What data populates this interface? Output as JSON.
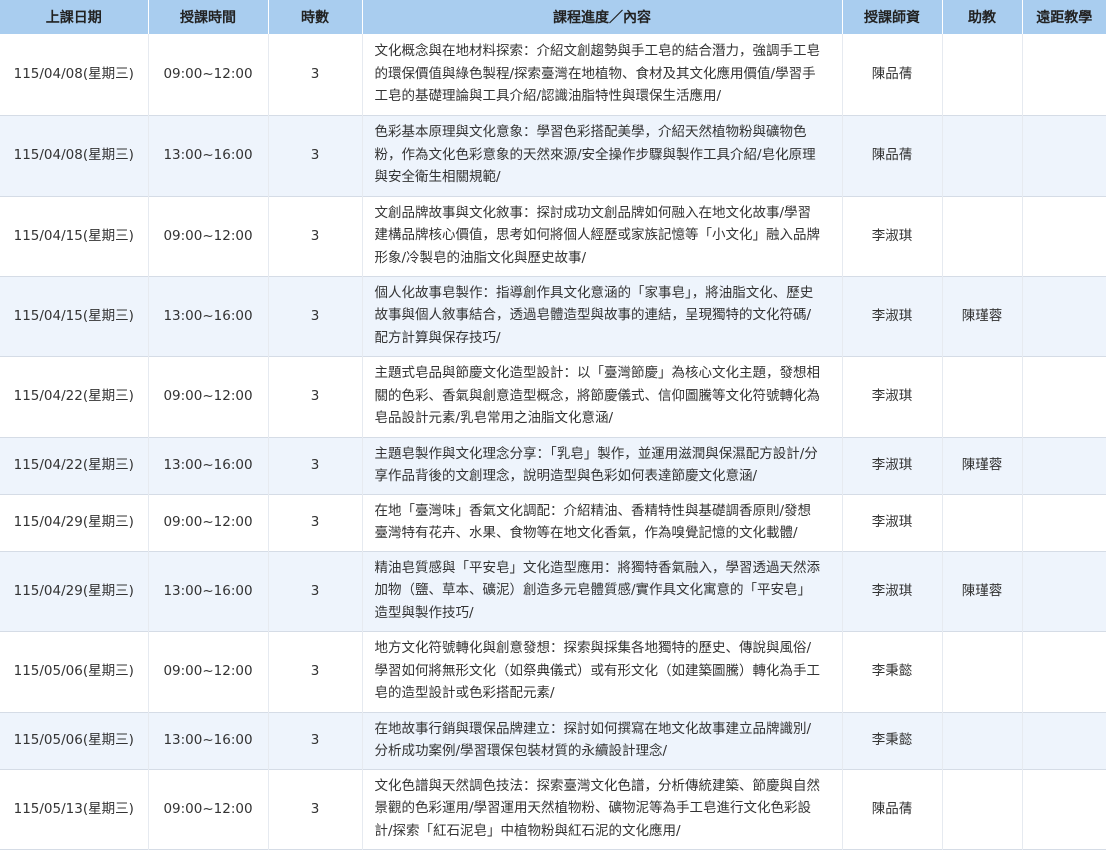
{
  "columns": [
    "上課日期",
    "授課時間",
    "時數",
    "課程進度／內容",
    "授課師資",
    "助教",
    "遠距教學"
  ],
  "rows": [
    {
      "date": "115/04/08(星期三)",
      "time": "09:00~12:00",
      "hours": "3",
      "content": "文化概念與在地材料探索：介紹文創趨勢與手工皂的結合潛力，強調手工皂的環保價值與綠色製程/探索臺灣在地植物、食材及其文化應用價值/學習手工皂的基礎理論與工具介紹/認識油脂特性與環保生活應用/",
      "teacher": "陳品蒨",
      "assistant": "",
      "remote": ""
    },
    {
      "date": "115/04/08(星期三)",
      "time": "13:00~16:00",
      "hours": "3",
      "content": "色彩基本原理與文化意象：學習色彩搭配美學，介紹天然植物粉與礦物色粉，作為文化色彩意象的天然來源/安全操作步驟與製作工具介紹/皂化原理與安全衛生相關規範/",
      "teacher": "陳品蒨",
      "assistant": "",
      "remote": ""
    },
    {
      "date": "115/04/15(星期三)",
      "time": "09:00~12:00",
      "hours": "3",
      "content": "文創品牌故事與文化敘事：探討成功文創品牌如何融入在地文化故事/學習建構品牌核心價值，思考如何將個人經歷或家族記憶等「小文化」融入品牌形象/冷製皂的油脂文化與歷史故事/",
      "teacher": "李淑琪",
      "assistant": "",
      "remote": ""
    },
    {
      "date": "115/04/15(星期三)",
      "time": "13:00~16:00",
      "hours": "3",
      "content": "個人化故事皂製作：指導創作具文化意涵的「家事皂」，將油脂文化、歷史故事與個人敘事結合，透過皂體造型與故事的連結，呈現獨特的文化符碼/配方計算與保存技巧/",
      "teacher": "李淑琪",
      "assistant": "陳瑾蓉",
      "remote": ""
    },
    {
      "date": "115/04/22(星期三)",
      "time": "09:00~12:00",
      "hours": "3",
      "content": "主題式皂品與節慶文化造型設計：以「臺灣節慶」為核心文化主題，發想相關的色彩、香氣與創意造型概念，將節慶儀式、信仰圖騰等文化符號轉化為皂品設計元素/乳皂常用之油脂文化意涵/",
      "teacher": "李淑琪",
      "assistant": "",
      "remote": ""
    },
    {
      "date": "115/04/22(星期三)",
      "time": "13:00~16:00",
      "hours": "3",
      "content": "主題皂製作與文化理念分享：「乳皂」製作，並運用滋潤與保濕配方設計/分享作品背後的文創理念，說明造型與色彩如何表達節慶文化意涵/",
      "teacher": "李淑琪",
      "assistant": "陳瑾蓉",
      "remote": ""
    },
    {
      "date": "115/04/29(星期三)",
      "time": "09:00~12:00",
      "hours": "3",
      "content": "在地「臺灣味」香氣文化調配：介紹精油、香精特性與基礎調香原則/發想臺灣特有花卉、水果、食物等在地文化香氣，作為嗅覺記憶的文化載體/",
      "teacher": "李淑琪",
      "assistant": "",
      "remote": ""
    },
    {
      "date": "115/04/29(星期三)",
      "time": "13:00~16:00",
      "hours": "3",
      "content": "精油皂質感與「平安皂」文化造型應用：將獨特香氣融入，學習透過天然添加物（鹽、草本、礦泥）創造多元皂體質感/實作具文化寓意的「平安皂」造型與製作技巧/",
      "teacher": "李淑琪",
      "assistant": "陳瑾蓉",
      "remote": ""
    },
    {
      "date": "115/05/06(星期三)",
      "time": "09:00~12:00",
      "hours": "3",
      "content": "地方文化符號轉化與創意發想：探索與採集各地獨特的歷史、傳說與風俗/學習如何將無形文化（如祭典儀式）或有形文化（如建築圖騰）轉化為手工皂的造型設計或色彩搭配元素/",
      "teacher": "李秉懿",
      "assistant": "",
      "remote": ""
    },
    {
      "date": "115/05/06(星期三)",
      "time": "13:00~16:00",
      "hours": "3",
      "content": "在地故事行銷與環保品牌建立：探討如何撰寫在地文化故事建立品牌識別/分析成功案例/學習環保包裝材質的永續設計理念/",
      "teacher": "李秉懿",
      "assistant": "",
      "remote": ""
    },
    {
      "date": "115/05/13(星期三)",
      "time": "09:00~12:00",
      "hours": "3",
      "content": "文化色譜與天然調色技法：探索臺灣文化色譜，分析傳統建築、節慶與自然景觀的色彩運用/學習運用天然植物粉、礦物泥等為手工皂進行文化色彩設計/探索「紅石泥皂」中植物粉與紅石泥的文化應用/",
      "teacher": "陳品蒨",
      "assistant": "",
      "remote": ""
    }
  ],
  "colors": {
    "header_bg": "#a9cdef",
    "row_alt_bg": "#eef4fc",
    "row_bg": "#ffffff",
    "text": "#333333"
  }
}
